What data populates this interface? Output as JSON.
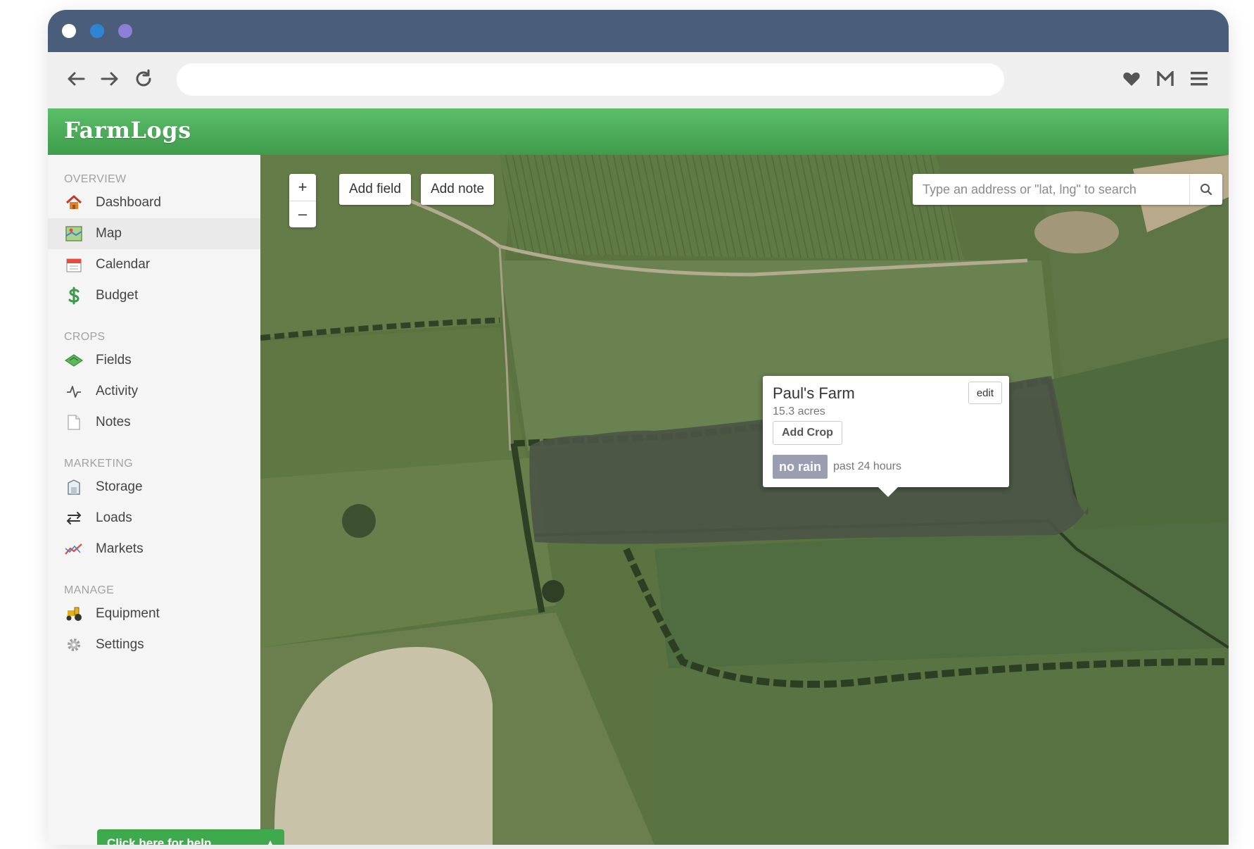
{
  "browser": {
    "window_dots": [
      "close",
      "minimize",
      "maximize"
    ],
    "url": "",
    "nav_icons": [
      "back-arrow-icon",
      "forward-arrow-icon",
      "reload-icon"
    ],
    "toolbar_icons": [
      "heart-icon",
      "gmail-icon",
      "menu-icon"
    ]
  },
  "app": {
    "logo": "FarmLogs"
  },
  "sidebar": {
    "sections": [
      {
        "title": "OVERVIEW",
        "items": [
          {
            "label": "Dashboard",
            "icon": "house-icon"
          },
          {
            "label": "Map",
            "icon": "map-icon",
            "active": true
          },
          {
            "label": "Calendar",
            "icon": "calendar-icon"
          },
          {
            "label": "Budget",
            "icon": "dollar-icon"
          }
        ]
      },
      {
        "title": "CROPS",
        "items": [
          {
            "label": "Fields",
            "icon": "field-icon"
          },
          {
            "label": "Activity",
            "icon": "activity-icon"
          },
          {
            "label": "Notes",
            "icon": "note-icon"
          }
        ]
      },
      {
        "title": "MARKETING",
        "items": [
          {
            "label": "Storage",
            "icon": "storage-icon"
          },
          {
            "label": "Loads",
            "icon": "loads-icon"
          },
          {
            "label": "Markets",
            "icon": "markets-icon"
          }
        ]
      },
      {
        "title": "MANAGE",
        "items": [
          {
            "label": "Equipment",
            "icon": "tractor-icon"
          },
          {
            "label": "Settings",
            "icon": "gear-icon"
          }
        ]
      }
    ],
    "help_button": "Click here for help"
  },
  "map": {
    "zoom_in": "+",
    "zoom_out": "–",
    "add_field": "Add field",
    "add_note": "Add note",
    "search_placeholder": "Type an address or \"lat, lng\" to search",
    "popup": {
      "field_name": "Paul's Farm",
      "acres": "15.3 acres",
      "edit_label": "edit",
      "add_crop_label": "Add Crop",
      "rain_status": "no rain",
      "rain_period": "past 24 hours"
    }
  },
  "colors": {
    "titlebar": "#4a5d7a",
    "brand_green": "#4caf50",
    "rain_badge": "#9b9db0"
  }
}
